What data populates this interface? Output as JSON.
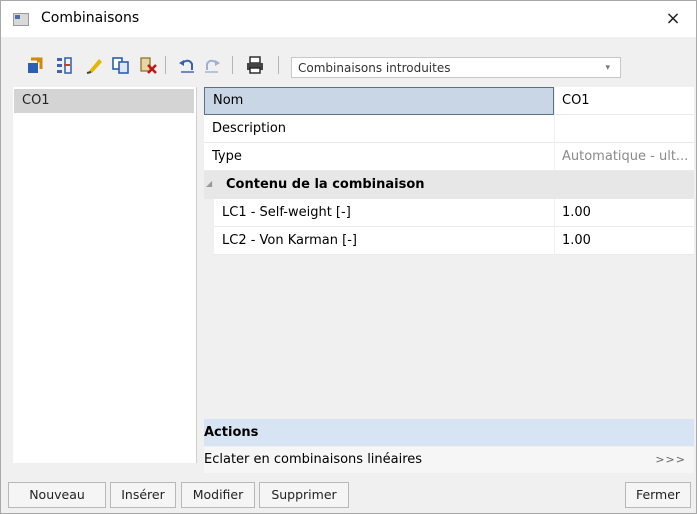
{
  "window": {
    "title": "Combinaisons",
    "close_glyph": "×"
  },
  "toolbar": {
    "icons": [
      "new-combination-icon",
      "insert-icon",
      "edit-icon",
      "copy-icon",
      "delete-icon",
      "undo-icon",
      "redo-icon",
      "print-icon"
    ],
    "filter_select": {
      "selected": "Combinaisons introduites"
    }
  },
  "list": {
    "items": [
      "CO1"
    ]
  },
  "properties": {
    "rows": [
      {
        "key": "Nom",
        "value": "CO1"
      },
      {
        "key": "Description",
        "value": ""
      },
      {
        "key": "Type",
        "value": "Automatique - ult..."
      }
    ],
    "group": {
      "title": "Contenu de la combinaison",
      "rows": [
        {
          "key": "LC1 - Self-weight [-]",
          "value": "1.00"
        },
        {
          "key": "LC2 - Von Karman [-]",
          "value": "1.00"
        }
      ]
    }
  },
  "actions": {
    "header": "Actions",
    "items": [
      {
        "label": "Eclater en combinaisons linéaires",
        "button": ">>>"
      }
    ]
  },
  "buttons": {
    "new": "Nouveau",
    "insert": "Insérer",
    "modify": "Modifier",
    "delete": "Supprimer",
    "close": "Fermer"
  }
}
